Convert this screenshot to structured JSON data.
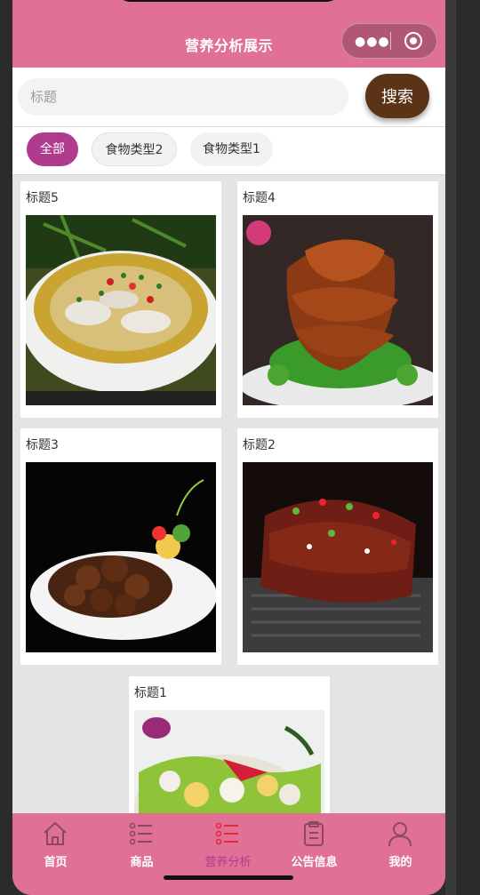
{
  "header": {
    "title": "营养分析展示"
  },
  "capsule": {
    "more_icon": "more-dots-icon",
    "close_icon": "target-icon"
  },
  "search": {
    "placeholder": "标题",
    "button_label": "搜索"
  },
  "tabs": [
    {
      "label": "全部",
      "active": true
    },
    {
      "label": "食物类型2",
      "active": false
    },
    {
      "label": "食物类型1",
      "active": false
    }
  ],
  "cards": [
    {
      "title": "标题5",
      "image": "fish-soup-photo"
    },
    {
      "title": "标题4",
      "image": "braised-fish-photo"
    },
    {
      "title": "标题3",
      "image": "braised-pork-photo"
    },
    {
      "title": "标题2",
      "image": "grilled-ribs-photo"
    },
    {
      "title": "标题1",
      "image": "salad-photo"
    }
  ],
  "tabbar": {
    "items": [
      {
        "label": "首页",
        "icon": "home-icon"
      },
      {
        "label": "商品",
        "icon": "list-icon"
      },
      {
        "label": "营养分析",
        "icon": "list-icon",
        "active": true
      },
      {
        "label": "公告信息",
        "icon": "clipboard-icon"
      },
      {
        "label": "我的",
        "icon": "user-icon"
      }
    ]
  },
  "colors": {
    "brand": "#e07095",
    "accent": "#b03a8e",
    "search_button": "#5b3418"
  }
}
